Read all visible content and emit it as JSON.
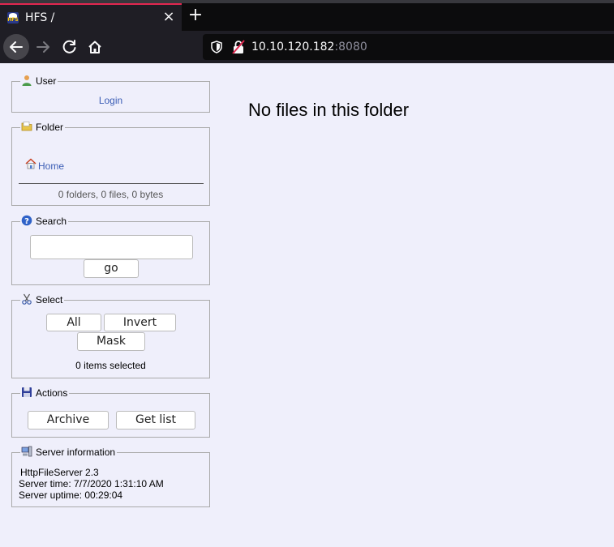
{
  "browser": {
    "tab_title": "HFS /",
    "tab_close": "×",
    "new_tab": "+",
    "url_host": "10.10.120.182",
    "url_port": ":8080",
    "favicon_text": "HFS"
  },
  "panels": {
    "user": {
      "legend": "User",
      "login_label": "Login"
    },
    "folder": {
      "legend": "Folder",
      "home_label": "Home",
      "summary": "0 folders, 0 files, 0 bytes"
    },
    "search": {
      "legend": "Search",
      "query_value": "",
      "go_label": "go"
    },
    "select": {
      "legend": "Select",
      "all_label": "All",
      "invert_label": "Invert",
      "mask_label": "Mask",
      "selected_count": "0 items selected"
    },
    "actions": {
      "legend": "Actions",
      "archive_label": "Archive",
      "get_list_label": "Get list"
    },
    "server": {
      "legend": "Server information",
      "software_label": "HttpFileServer 2.3",
      "server_time": "Server time: 7/7/2020 1:31:10 AM",
      "server_uptime": "Server uptime: 00:29:04"
    }
  },
  "main": {
    "message": "No files in this folder"
  },
  "colors": {
    "page_bg": "#efeffb",
    "link": "#3b5db5",
    "tab_accent": "#e22850",
    "chrome_bg": "#1f1e25"
  },
  "icons": [
    "back-arrow-icon",
    "forward-arrow-icon",
    "reload-icon",
    "home-icon",
    "shield-icon",
    "insecure-lock-icon",
    "user-icon",
    "folder-icon",
    "house-icon",
    "help-icon",
    "scissors-icon",
    "floppy-disk-icon",
    "server-icon"
  ]
}
